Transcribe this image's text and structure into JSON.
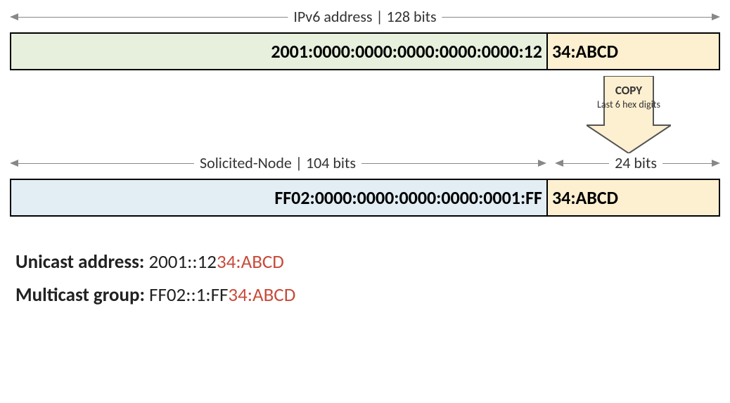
{
  "top_bracket_label": "IPv6 address | 128 bits",
  "addr1": {
    "prefix": "2001:0000:0000:0000:0000:0000:12",
    "suffix": "34:ABCD"
  },
  "copy_label_bold": "COPY",
  "copy_label_sub": "Last 6 hex digits",
  "bracket2_left_label": "Solicited-Node | 104 bits",
  "bracket2_right_label": "24 bits",
  "addr2": {
    "prefix": "FF02:0000:0000:0000:0000:0001:FF",
    "suffix": "34:ABCD"
  },
  "unicast": {
    "label": "Unicast address: ",
    "black": "2001::12",
    "red": "34:ABCD"
  },
  "multicast": {
    "label": "Multicast group: ",
    "black": "FF02::1:FF",
    "red": "34:ABCD"
  }
}
